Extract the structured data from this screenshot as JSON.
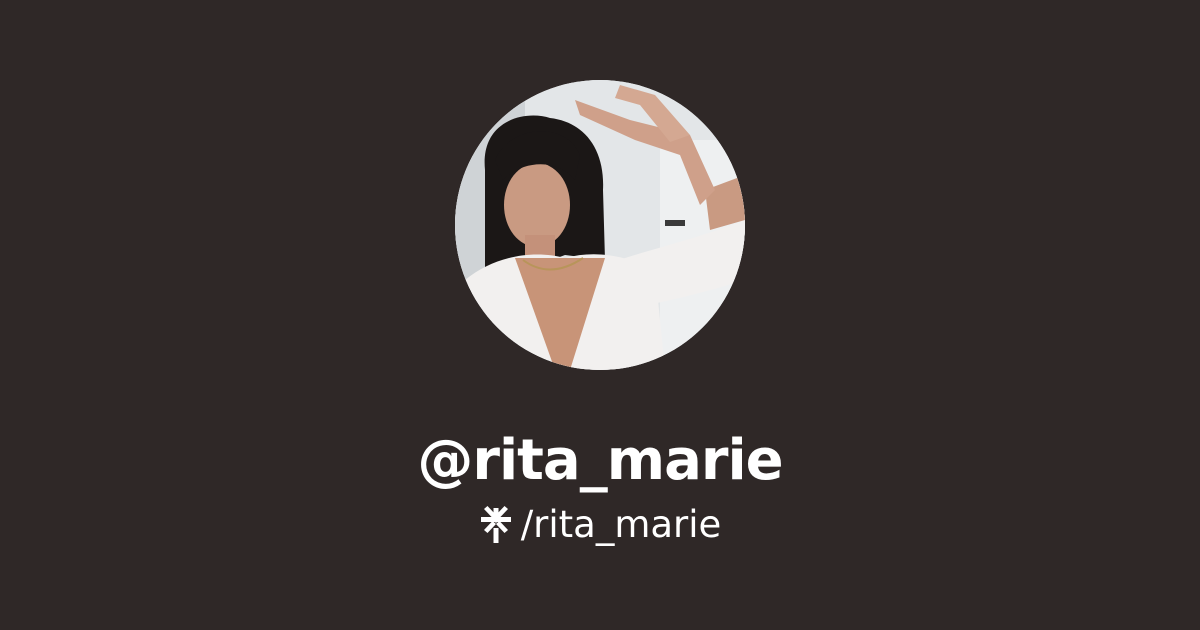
{
  "profile": {
    "username": "@rita_marie",
    "link_path": "/rita_marie",
    "avatar_icon": "profile-photo",
    "link_icon": "linktree-asterisk-icon"
  },
  "colors": {
    "background": "#2f2827",
    "text": "#ffffff"
  }
}
